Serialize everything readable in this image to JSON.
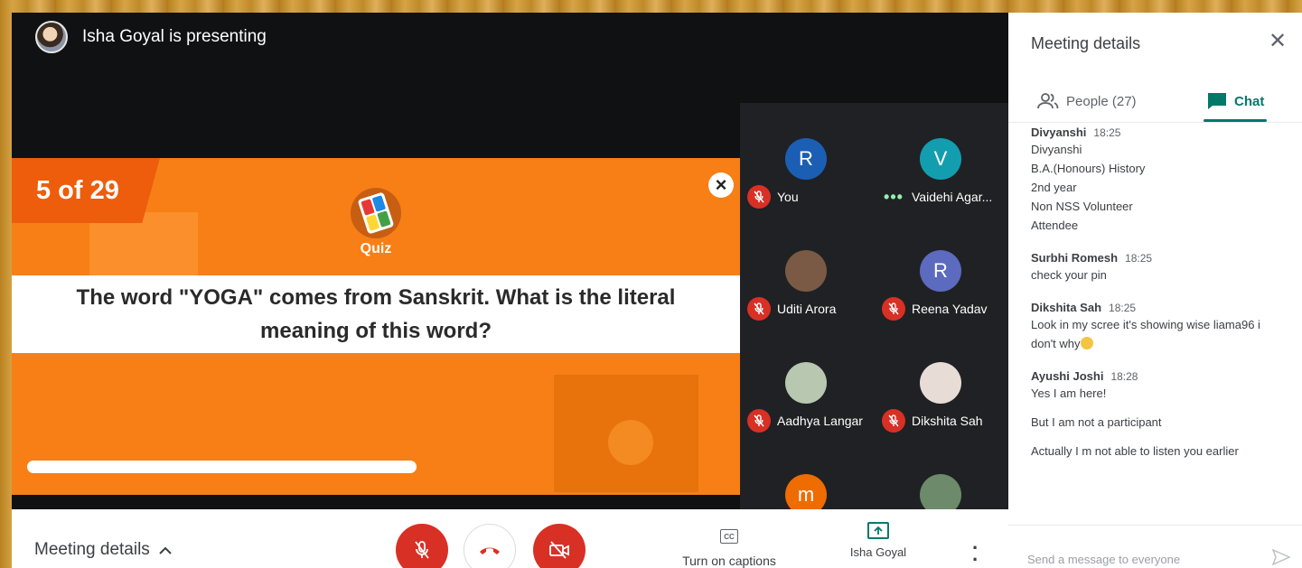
{
  "presenter": {
    "text": "Isha Goyal is presenting"
  },
  "slide": {
    "counter": "5 of 29",
    "badge": "Quiz",
    "question": "The word \"YOGA\" comes from Sanskrit. What is the literal meaning of this word?",
    "accent": "#f77f16"
  },
  "participants": [
    {
      "initial": "R",
      "name": "You",
      "color": "#1a5fb4",
      "status": "muted"
    },
    {
      "initial": "V",
      "name": "Vaidehi Agar...",
      "color": "#129eaf",
      "status": "speaking"
    },
    {
      "initial": "",
      "name": "Uditi Arora",
      "color": "#7a5a44",
      "status": "muted"
    },
    {
      "initial": "R",
      "name": "Reena Yadav",
      "color": "#5c6bc0",
      "status": "muted"
    },
    {
      "initial": "",
      "name": "Aadhya Langar",
      "color": "#b7c7b0",
      "status": "muted"
    },
    {
      "initial": "",
      "name": "Dikshita Sah",
      "color": "#e8dcd6",
      "status": "muted"
    },
    {
      "initial": "m",
      "name": "",
      "color": "#ef6c00",
      "status": ""
    },
    {
      "initial": "",
      "name": "",
      "color": "#6d8a6a",
      "status": ""
    }
  ],
  "panel": {
    "title": "Meeting details",
    "tab_people": "People (27)",
    "tab_chat": "Chat",
    "send_placeholder": "Send a message to everyone",
    "accent": "#00796b"
  },
  "chat": [
    {
      "author": "Divyanshi",
      "time": "18:25",
      "lines": [
        "Divyanshi",
        "B.A.(Honours) History",
        "2nd year",
        "Non NSS Volunteer",
        "Attendee"
      ]
    },
    {
      "author": "Surbhi Romesh",
      "time": "18:25",
      "lines": [
        "check your pin"
      ]
    },
    {
      "author": "Dikshita Sah",
      "time": "18:25",
      "lines": [
        "Look in my scree it's showing wise liama96 i",
        "don't why"
      ]
    },
    {
      "author": "Ayushi Joshi",
      "time": "18:28",
      "lines": [
        "Yes I am here!",
        "But I am not a participant",
        "Actually I m not able to listen you earlier"
      ]
    }
  ],
  "bottombar": {
    "meeting_details": "Meeting details",
    "captions": "Turn on captions",
    "presenting_label": "Isha Goyal",
    "danger_color": "#d93025"
  }
}
